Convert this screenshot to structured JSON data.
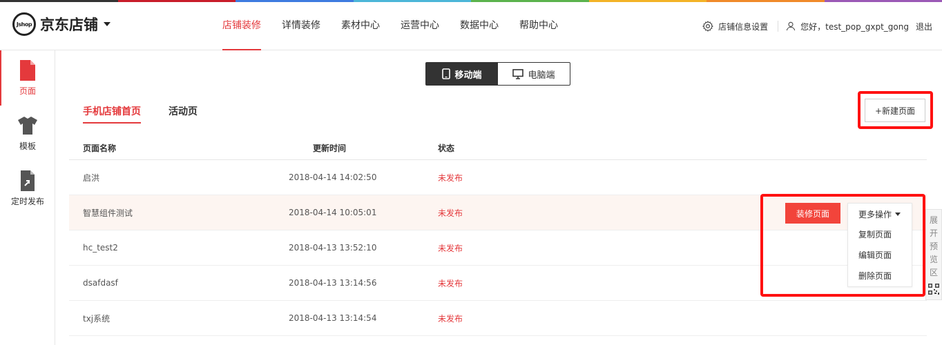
{
  "brand": {
    "logo_mark": "Jshop",
    "name": "京东店铺"
  },
  "rainbow_colors": [
    "#333333",
    "#c81d2a",
    "#3e7be0",
    "#4cb6d8",
    "#5bb34d",
    "#f3b327",
    "#f08a2a",
    "#9b59b6"
  ],
  "accent_color": "#e4393c",
  "main_nav": [
    {
      "label": "店铺装修",
      "active": true
    },
    {
      "label": "详情装修"
    },
    {
      "label": "素材中心"
    },
    {
      "label": "运营中心"
    },
    {
      "label": "数据中心"
    },
    {
      "label": "帮助中心"
    }
  ],
  "top_right": {
    "settings_label": "店铺信息设置",
    "greeting": "您好，test_pop_gxpt_gong",
    "logout_label": "退出"
  },
  "sidebar": [
    {
      "label": "页面",
      "icon": "page-icon",
      "active": true
    },
    {
      "label": "模板",
      "icon": "tshirt-icon"
    },
    {
      "label": "定时发布",
      "icon": "scheduled-publish-icon"
    }
  ],
  "device_toggle": {
    "mobile": "移动端",
    "pc": "电脑端"
  },
  "sub_tabs": [
    {
      "label": "手机店铺首页",
      "active": true
    },
    {
      "label": "活动页"
    }
  ],
  "new_page_label": "+新建页面",
  "table": {
    "headers": {
      "name": "页面名称",
      "time": "更新时间",
      "status": "状态"
    },
    "rows": [
      {
        "name": "启洪",
        "time": "2018-04-14 14:02:50",
        "status": "未发布"
      },
      {
        "name": "智慧组件测试",
        "time": "2018-04-14 10:05:01",
        "status": "未发布"
      },
      {
        "name": "hc_test2",
        "time": "2018-04-13 13:52:10",
        "status": "未发布"
      },
      {
        "name": "dsafdasf",
        "time": "2018-04-13 13:14:56",
        "status": "未发布"
      },
      {
        "name": "txj系统",
        "time": "2018-04-13 13:14:54",
        "status": "未发布"
      }
    ]
  },
  "row_actions": {
    "decorate_label": "装修页面",
    "more_label": "更多操作",
    "more_items": [
      "复制页面",
      "编辑页面",
      "删除页面"
    ]
  },
  "preview_tab": {
    "chars": [
      "展",
      "开",
      "预",
      "览",
      "区"
    ]
  }
}
